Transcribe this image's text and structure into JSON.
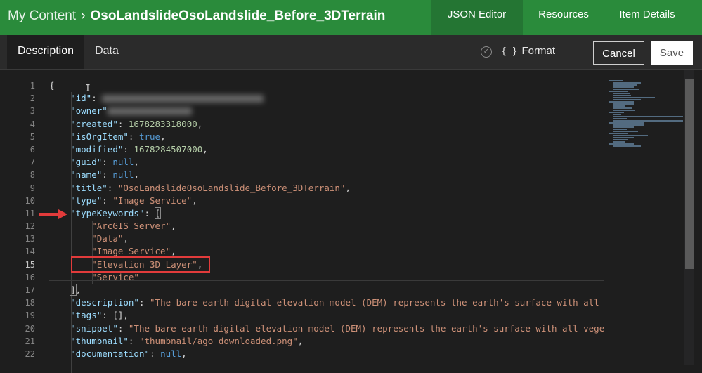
{
  "header": {
    "breadcrumb_root": "My Content",
    "separator": "›",
    "item_title": "OsoLandslideOsoLandslide_Before_3DTerrain",
    "tabs": [
      {
        "label": "JSON Editor"
      },
      {
        "label": "Resources"
      },
      {
        "label": "Item Details"
      }
    ],
    "active_tab": "JSON Editor"
  },
  "toolbar": {
    "tabs": [
      {
        "label": "Description"
      },
      {
        "label": "Data"
      }
    ],
    "active_tab": "Description",
    "format_label": "Format",
    "format_icon": "{ }",
    "validate_icon": "check-circle-icon",
    "cancel_label": "Cancel",
    "save_label": "Save"
  },
  "editor": {
    "line_numbers": [
      "1",
      "2",
      "3",
      "4",
      "5",
      "6",
      "7",
      "8",
      "9",
      "10",
      "11",
      "12",
      "13",
      "14",
      "15",
      "16",
      "17",
      "18",
      "19",
      "20",
      "21",
      "22"
    ],
    "current_line": "15",
    "lines": [
      {
        "tokens": [
          {
            "t": "{",
            "c": "p"
          }
        ]
      },
      {
        "tokens": [
          {
            "t": "    ",
            "c": "p"
          },
          {
            "t": "\"id\"",
            "c": "k"
          },
          {
            "t": ": ",
            "c": "p"
          },
          {
            "blur": 230
          }
        ]
      },
      {
        "tokens": [
          {
            "t": "    ",
            "c": "p"
          },
          {
            "t": "\"owner\"",
            "c": "k"
          },
          {
            "blur": 120
          }
        ]
      },
      {
        "tokens": [
          {
            "t": "    ",
            "c": "p"
          },
          {
            "t": "\"created\"",
            "c": "k"
          },
          {
            "t": ": ",
            "c": "p"
          },
          {
            "t": "1678283318000",
            "c": "n"
          },
          {
            "t": ",",
            "c": "p"
          }
        ]
      },
      {
        "tokens": [
          {
            "t": "    ",
            "c": "p"
          },
          {
            "t": "\"isOrgItem\"",
            "c": "k"
          },
          {
            "t": ": ",
            "c": "p"
          },
          {
            "t": "true",
            "c": "b"
          },
          {
            "t": ",",
            "c": "p"
          }
        ]
      },
      {
        "tokens": [
          {
            "t": "    ",
            "c": "p"
          },
          {
            "t": "\"modified\"",
            "c": "k"
          },
          {
            "t": ": ",
            "c": "p"
          },
          {
            "t": "1678284507000",
            "c": "n"
          },
          {
            "t": ",",
            "c": "p"
          }
        ]
      },
      {
        "tokens": [
          {
            "t": "    ",
            "c": "p"
          },
          {
            "t": "\"guid\"",
            "c": "k"
          },
          {
            "t": ": ",
            "c": "p"
          },
          {
            "t": "null",
            "c": "b"
          },
          {
            "t": ",",
            "c": "p"
          }
        ]
      },
      {
        "tokens": [
          {
            "t": "    ",
            "c": "p"
          },
          {
            "t": "\"name\"",
            "c": "k"
          },
          {
            "t": ": ",
            "c": "p"
          },
          {
            "t": "null",
            "c": "b"
          },
          {
            "t": ",",
            "c": "p"
          }
        ]
      },
      {
        "tokens": [
          {
            "t": "    ",
            "c": "p"
          },
          {
            "t": "\"title\"",
            "c": "k"
          },
          {
            "t": ": ",
            "c": "p"
          },
          {
            "t": "\"OsoLandslideOsoLandslide_Before_3DTerrain\"",
            "c": "s"
          },
          {
            "t": ",",
            "c": "p"
          }
        ]
      },
      {
        "tokens": [
          {
            "t": "    ",
            "c": "p"
          },
          {
            "t": "\"type\"",
            "c": "k"
          },
          {
            "t": ": ",
            "c": "p"
          },
          {
            "t": "\"Image Service\"",
            "c": "s"
          },
          {
            "t": ",",
            "c": "p"
          }
        ]
      },
      {
        "tokens": [
          {
            "t": "    ",
            "c": "p"
          },
          {
            "t": "\"typeKeywords\"",
            "c": "k"
          },
          {
            "t": ": ",
            "c": "p"
          },
          {
            "t": "[",
            "c": "p",
            "box": true
          }
        ]
      },
      {
        "tokens": [
          {
            "t": "        ",
            "c": "p"
          },
          {
            "t": "\"ArcGIS Server\"",
            "c": "s"
          },
          {
            "t": ",",
            "c": "p"
          }
        ]
      },
      {
        "tokens": [
          {
            "t": "        ",
            "c": "p"
          },
          {
            "t": "\"Data\"",
            "c": "s"
          },
          {
            "t": ",",
            "c": "p"
          }
        ]
      },
      {
        "tokens": [
          {
            "t": "        ",
            "c": "p"
          },
          {
            "t": "\"Image Service\"",
            "c": "s"
          },
          {
            "t": ",",
            "c": "p"
          }
        ]
      },
      {
        "tokens": [
          {
            "t": "        ",
            "c": "p"
          },
          {
            "t": "\"Elevation 3D Layer\"",
            "c": "s"
          },
          {
            "t": ",",
            "c": "p"
          }
        ]
      },
      {
        "tokens": [
          {
            "t": "        ",
            "c": "p"
          },
          {
            "t": "\"Service\"",
            "c": "s"
          }
        ]
      },
      {
        "tokens": [
          {
            "t": "    ",
            "c": "p"
          },
          {
            "t": "]",
            "c": "p",
            "box": true
          },
          {
            "t": ",",
            "c": "p"
          }
        ]
      },
      {
        "tokens": [
          {
            "t": "    ",
            "c": "p"
          },
          {
            "t": "\"description\"",
            "c": "k"
          },
          {
            "t": ": ",
            "c": "p"
          },
          {
            "t": "\"The bare earth digital elevation model (DEM) represents the earth's surface with all veg",
            "c": "s"
          }
        ]
      },
      {
        "tokens": [
          {
            "t": "    ",
            "c": "p"
          },
          {
            "t": "\"tags\"",
            "c": "k"
          },
          {
            "t": ": ",
            "c": "p"
          },
          {
            "t": "[]",
            "c": "p"
          },
          {
            "t": ",",
            "c": "p"
          }
        ]
      },
      {
        "tokens": [
          {
            "t": "    ",
            "c": "p"
          },
          {
            "t": "\"snippet\"",
            "c": "k"
          },
          {
            "t": ": ",
            "c": "p"
          },
          {
            "t": "\"The bare earth digital elevation model (DEM) represents the earth's surface with all vegeta",
            "c": "s"
          }
        ]
      },
      {
        "tokens": [
          {
            "t": "    ",
            "c": "p"
          },
          {
            "t": "\"thumbnail\"",
            "c": "k"
          },
          {
            "t": ": ",
            "c": "p"
          },
          {
            "t": "\"thumbnail/ago_downloaded.png\"",
            "c": "s"
          },
          {
            "t": ",",
            "c": "p"
          }
        ]
      },
      {
        "tokens": [
          {
            "t": "    ",
            "c": "p"
          },
          {
            "t": "\"documentation\"",
            "c": "k"
          },
          {
            "t": ": ",
            "c": "p"
          },
          {
            "t": "null",
            "c": "b"
          },
          {
            "t": ",",
            "c": "p"
          }
        ]
      }
    ],
    "syntax_colors": {
      "key": "#9cdcfe",
      "string": "#ce9178",
      "number": "#b5cea8",
      "keyword": "#569cd6",
      "punctuation": "#d4d4d4"
    }
  },
  "colors": {
    "brand": "#2a8b3b",
    "annotation": "#e23b3b"
  }
}
